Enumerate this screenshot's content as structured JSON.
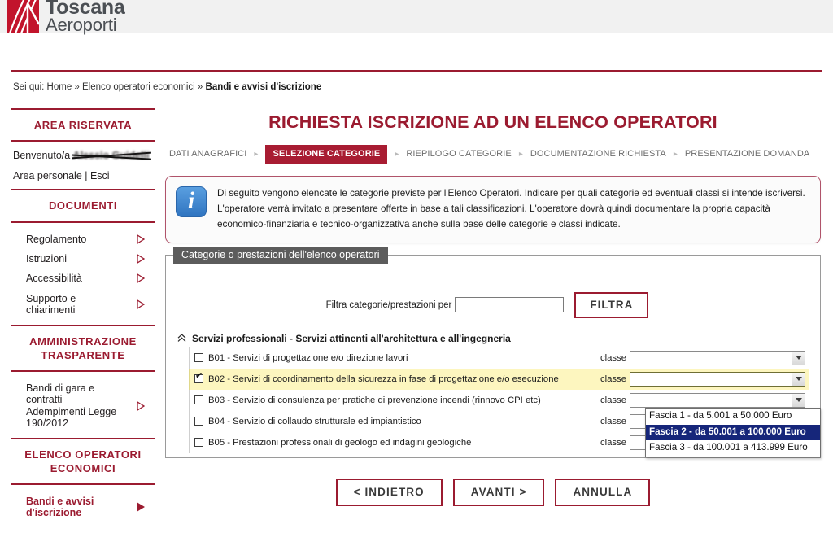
{
  "brand": {
    "name_line1": "Toscana",
    "name_line2": "Aeroporti",
    "red": "#c2142c",
    "gray": "#4b4f54"
  },
  "breadcrumb": {
    "prefix": "Sei qui: Home » Elenco operatori economici » ",
    "current": "Bandi e avvisi d'iscrizione"
  },
  "sidebar": {
    "reserved_area_title": "AREA RISERVATA",
    "welcome_prefix": "Benvenuto/a ",
    "welcome_user": "Alessio Guidelli",
    "account_links": "Area personale | Esci",
    "documenti_title": "DOCUMENTI",
    "documenti_links": [
      {
        "label": "Regolamento"
      },
      {
        "label": "Istruzioni"
      },
      {
        "label": "Accessibilità"
      },
      {
        "label": "Supporto e chiarimenti"
      }
    ],
    "amministrazione_title": "AMMINISTRAZIONE TRASPARENTE",
    "amministrazione_links": [
      {
        "label": "Bandi di gara e contratti - Adempimenti Legge 190/2012"
      }
    ],
    "elenco_title": "ELENCO OPERATORI ECONOMICI",
    "elenco_links": [
      {
        "label": "Bandi e avvisi d'iscrizione"
      }
    ]
  },
  "main": {
    "page_title": "RICHIESTA ISCRIZIONE AD UN ELENCO OPERATORI",
    "steps": [
      {
        "label": "DATI ANAGRAFICI",
        "active": false
      },
      {
        "label": "SELEZIONE CATEGORIE",
        "active": true
      },
      {
        "label": "RIEPILOGO CATEGORIE",
        "active": false
      },
      {
        "label": "DOCUMENTAZIONE RICHIESTA",
        "active": false
      },
      {
        "label": "PRESENTAZIONE DOMANDA",
        "active": false
      }
    ],
    "info_icon": "info-icon",
    "info_text": "Di seguito vengono elencate le categorie previste per l'Elenco Operatori. Indicare per quali categorie ed eventuali classi si intende iscriversi. L'operatore verrà invitato a presentare offerte in base a tali classificazioni. L'operatore dovrà quindi documentare la propria capacità economico-finanziaria e tecnico-organizzativa anche sulla base delle categorie e classi indicate."
  },
  "panel": {
    "legend": "Categorie o prestazioni dell'elenco operatori",
    "filter_label": "Filtra categorie/prestazioni per",
    "filter_value": "",
    "filter_placeholder": "",
    "filter_button": "FILTRA",
    "group_title": "Servizi professionali - Servizi attinenti all'architettura e all'ingegneria",
    "classe_label": "classe",
    "rows": [
      {
        "code": "B01",
        "label": "B01 - Servizi di progettazione e/o direzione lavori",
        "checked": false,
        "classe_value": ""
      },
      {
        "code": "B02",
        "label": "B02 - Servizi di coordinamento della sicurezza in fase di progettazione e/o esecuzione",
        "checked": true,
        "classe_value": ""
      },
      {
        "code": "B03",
        "label": "B03 - Servizio di consulenza per pratiche di prevenzione incendi (rinnovo CPI etc)",
        "checked": false,
        "classe_value": ""
      },
      {
        "code": "B04",
        "label": "B04 - Servizio di collaudo strutturale ed impiantistico",
        "checked": false,
        "classe_value": ""
      },
      {
        "code": "B05",
        "label": "B05 - Prestazioni professionali di geologo ed indagini geologiche",
        "checked": false,
        "classe_value": ""
      }
    ]
  },
  "dropdown": {
    "open": true,
    "options": [
      {
        "label": "Fascia 1 - da 5.001 a 50.000 Euro",
        "selected": false
      },
      {
        "label": "Fascia 2 - da 50.001 a 100.000 Euro",
        "selected": true
      },
      {
        "label": "Fascia 3 - da 100.001 a 413.999 Euro",
        "selected": false
      }
    ]
  },
  "actions": [
    {
      "label": "< INDIETRO"
    },
    {
      "label": "AVANTI >"
    },
    {
      "label": "ANNULLA"
    }
  ]
}
